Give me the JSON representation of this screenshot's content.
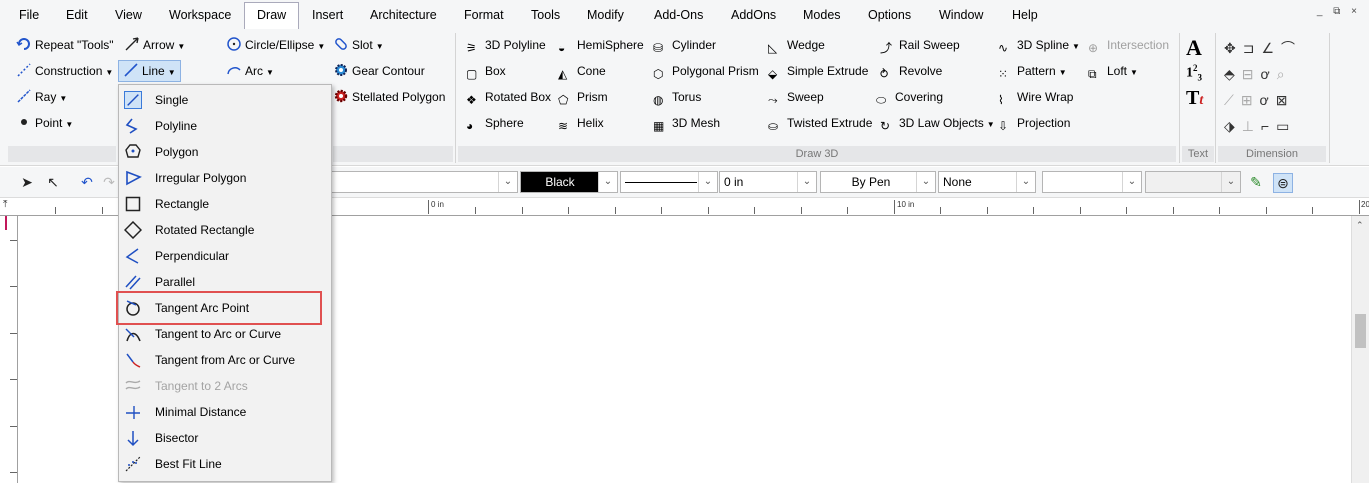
{
  "menubar": {
    "items": [
      "File",
      "Edit",
      "View",
      "Workspace",
      "Draw",
      "Insert",
      "Architecture",
      "Format",
      "Tools",
      "Modify",
      "Add-Ons",
      "AddOns",
      "Modes",
      "Options",
      "Window",
      "Help"
    ],
    "active": "Draw",
    "window_controls": "_ ⧉ ×"
  },
  "ribbon": {
    "col1": {
      "repeat": "Repeat \"Tools\"",
      "construction": "Construction",
      "ray": "Ray",
      "point": "Point"
    },
    "col2": {
      "arrow": "Arrow",
      "line": "Line"
    },
    "col3": {
      "circle": "Circle/Ellipse",
      "arc": "Arc"
    },
    "col4": {
      "slot": "Slot",
      "gear": "Gear Contour",
      "stellated": "Stellated Polygon"
    },
    "draw3d": {
      "c1": [
        "3D Polyline",
        "Box",
        "Rotated Box",
        "Sphere"
      ],
      "c2": [
        "HemiSphere",
        "Cone",
        "Prism",
        "Helix"
      ],
      "c3": [
        "Cylinder",
        "Polygonal Prism",
        "Torus",
        "3D Mesh"
      ],
      "c4": [
        "Wedge",
        "Simple Extrude",
        "Sweep",
        "Twisted Extrude"
      ],
      "c5": [
        "Rail Sweep",
        "Revolve",
        "Covering",
        "3D Law Objects"
      ],
      "c6": [
        "3D Spline",
        "Pattern",
        "Wire Wrap",
        "Projection"
      ],
      "c7": [
        "Intersection",
        "Loft"
      ]
    },
    "groups": {
      "draw3d": "Draw 3D",
      "text": "Text",
      "dimension": "Dimension"
    }
  },
  "toolbar": {
    "color": "Black",
    "thickness": "0 in",
    "pen": "By Pen",
    "fill": "None"
  },
  "ruler": {
    "label0": "0 in",
    "label10": "10 in",
    "label20": "20"
  },
  "line_menu": {
    "items": [
      {
        "label": "Single",
        "icon": "single-line-icon",
        "enabled": true
      },
      {
        "label": "Polyline",
        "icon": "polyline-icon",
        "enabled": true
      },
      {
        "label": "Polygon",
        "icon": "polygon-icon",
        "enabled": true
      },
      {
        "label": "Irregular Polygon",
        "icon": "irregular-polygon-icon",
        "enabled": true
      },
      {
        "label": "Rectangle",
        "icon": "rectangle-icon",
        "enabled": true
      },
      {
        "label": "Rotated Rectangle",
        "icon": "rotated-rectangle-icon",
        "enabled": true
      },
      {
        "label": "Perpendicular",
        "icon": "perpendicular-icon",
        "enabled": true
      },
      {
        "label": "Parallel",
        "icon": "parallel-icon",
        "enabled": true
      },
      {
        "label": "Tangent Arc Point",
        "icon": "tangent-arc-point-icon",
        "enabled": true
      },
      {
        "label": "Tangent to Arc or Curve",
        "icon": "tangent-to-arc-icon",
        "enabled": true
      },
      {
        "label": "Tangent from Arc or Curve",
        "icon": "tangent-from-arc-icon",
        "enabled": true
      },
      {
        "label": "Tangent to 2 Arcs",
        "icon": "tangent-two-arcs-icon",
        "enabled": false
      },
      {
        "label": "Minimal Distance",
        "icon": "minimal-distance-icon",
        "enabled": true
      },
      {
        "label": "Bisector",
        "icon": "bisector-icon",
        "enabled": true
      },
      {
        "label": "Best Fit Line",
        "icon": "best-fit-line-icon",
        "enabled": true
      }
    ],
    "highlighted": "Tangent Arc Point"
  },
  "colors": {
    "accent": "#3b7ad9",
    "highlight_border": "#e05050",
    "ribbon_bg": "#f5f6f7"
  }
}
